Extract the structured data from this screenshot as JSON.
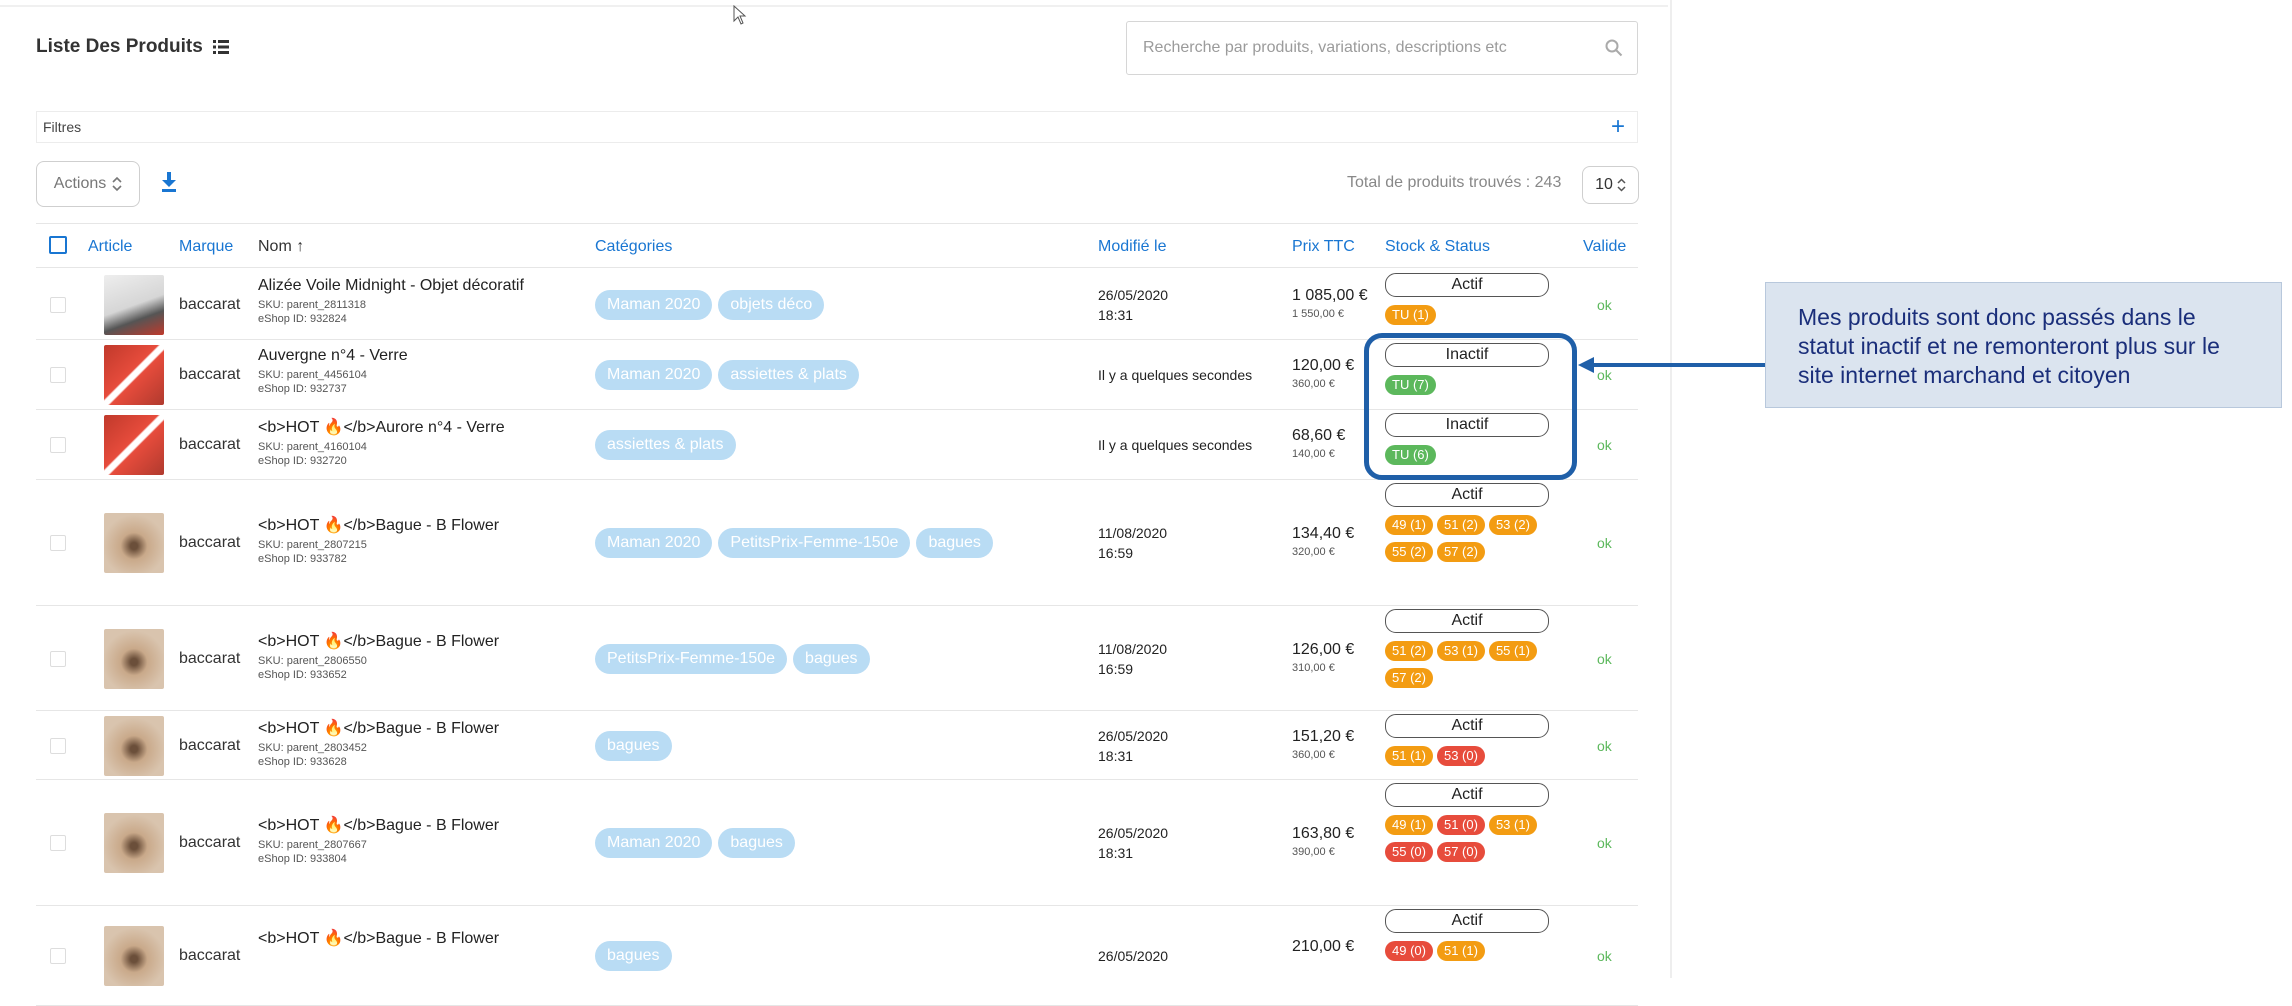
{
  "page": {
    "title": "Liste Des Produits"
  },
  "search": {
    "placeholder": "Recherche par produits, variations, descriptions etc"
  },
  "filters": {
    "label": "Filtres"
  },
  "toolbar": {
    "actions_label": "Actions",
    "total_text": "Total de produits trouvés : 243",
    "page_size": "10"
  },
  "columns": [
    "Article",
    "Marque",
    "Nom",
    "Catégories",
    "Modifié le",
    "Prix TTC",
    "Stock & Status",
    "Valide"
  ],
  "colors": {
    "accent": "#1976d2",
    "tag": "#b9dcf4",
    "orange": "#f39c12",
    "red": "#e74c3c",
    "green": "#5cb85c",
    "callout_border": "#1f5fa8"
  },
  "rows": [
    {
      "brand": "baccarat",
      "name": "Alizée Voile Midnight - Objet décoratif",
      "sku": "SKU: parent_2811318",
      "eshop": "eShop ID: 932824",
      "categories": [
        "Maman 2020",
        "objets déco"
      ],
      "modified": [
        "26/05/2020",
        "18:31"
      ],
      "price": "1 085,00 €",
      "old_price": "1 550,00 €",
      "status": "Actif",
      "badges": [
        {
          "label": "TU (1)",
          "color": "orange"
        }
      ],
      "valid": "ok"
    },
    {
      "brand": "baccarat",
      "name": "Auvergne n°4 - Verre",
      "sku": "SKU: parent_4456104",
      "eshop": "eShop ID: 932737",
      "categories": [
        "Maman 2020",
        "assiettes & plats"
      ],
      "modified": [
        "Il y a quelques secondes"
      ],
      "price": "120,00 €",
      "old_price": "360,00 €",
      "status": "Inactif",
      "badges": [
        {
          "label": "TU (7)",
          "color": "green"
        }
      ],
      "valid": "ok"
    },
    {
      "brand": "baccarat",
      "name": "<b>HOT 🔥</b>Aurore n°4 - Verre",
      "sku": "SKU: parent_4160104",
      "eshop": "eShop ID: 932720",
      "categories": [
        "assiettes & plats"
      ],
      "modified": [
        "Il y a quelques secondes"
      ],
      "price": "68,60 €",
      "old_price": "140,00 €",
      "status": "Inactif",
      "badges": [
        {
          "label": "TU (6)",
          "color": "green"
        }
      ],
      "valid": "ok"
    },
    {
      "brand": "baccarat",
      "name": "<b>HOT 🔥</b>Bague - B Flower",
      "sku": "SKU: parent_2807215",
      "eshop": "eShop ID: 933782",
      "categories": [
        "Maman 2020",
        "PetitsPrix-Femme-150e",
        "bagues"
      ],
      "modified": [
        "11/08/2020",
        "16:59"
      ],
      "price": "134,40 €",
      "old_price": "320,00 €",
      "status": "Actif",
      "badges": [
        {
          "label": "49 (1)",
          "color": "orange"
        },
        {
          "label": "51 (2)",
          "color": "orange"
        },
        {
          "label": "53 (2)",
          "color": "orange"
        },
        {
          "label": "55 (2)",
          "color": "orange"
        },
        {
          "label": "57 (2)",
          "color": "orange"
        }
      ],
      "valid": "ok"
    },
    {
      "brand": "baccarat",
      "name": "<b>HOT 🔥</b>Bague - B Flower",
      "sku": "SKU: parent_2806550",
      "eshop": "eShop ID: 933652",
      "categories": [
        "PetitsPrix-Femme-150e",
        "bagues"
      ],
      "modified": [
        "11/08/2020",
        "16:59"
      ],
      "price": "126,00 €",
      "old_price": "310,00 €",
      "status": "Actif",
      "badges": [
        {
          "label": "51 (2)",
          "color": "orange"
        },
        {
          "label": "53 (1)",
          "color": "orange"
        },
        {
          "label": "55 (1)",
          "color": "orange"
        },
        {
          "label": "57 (2)",
          "color": "orange"
        }
      ],
      "valid": "ok"
    },
    {
      "brand": "baccarat",
      "name": "<b>HOT 🔥</b>Bague - B Flower",
      "sku": "SKU: parent_2803452",
      "eshop": "eShop ID: 933628",
      "categories": [
        "bagues"
      ],
      "modified": [
        "26/05/2020",
        "18:31"
      ],
      "price": "151,20 €",
      "old_price": "360,00 €",
      "status": "Actif",
      "badges": [
        {
          "label": "51 (1)",
          "color": "orange"
        },
        {
          "label": "53 (0)",
          "color": "red"
        }
      ],
      "valid": "ok"
    },
    {
      "brand": "baccarat",
      "name": "<b>HOT 🔥</b>Bague - B Flower",
      "sku": "SKU: parent_2807667",
      "eshop": "eShop ID: 933804",
      "categories": [
        "Maman 2020",
        "bagues"
      ],
      "modified": [
        "26/05/2020",
        "18:31"
      ],
      "price": "163,80 €",
      "old_price": "390,00 €",
      "status": "Actif",
      "badges": [
        {
          "label": "49 (1)",
          "color": "orange"
        },
        {
          "label": "51 (0)",
          "color": "red"
        },
        {
          "label": "53 (1)",
          "color": "orange"
        },
        {
          "label": "55 (0)",
          "color": "red"
        },
        {
          "label": "57 (0)",
          "color": "red"
        }
      ],
      "valid": "ok"
    },
    {
      "brand": "baccarat",
      "name": "<b>HOT 🔥</b>Bague - B Flower",
      "sku": "",
      "eshop": "",
      "categories": [
        "bagues"
      ],
      "modified": [
        "26/05/2020"
      ],
      "price": "210,00 €",
      "old_price": "",
      "status": "Actif",
      "badges": [
        {
          "label": "49 (0)",
          "color": "red"
        },
        {
          "label": "51 (1)",
          "color": "orange"
        }
      ],
      "valid": "ok"
    }
  ],
  "callout": {
    "text": "Mes produits sont donc passés dans le statut inactif et ne remonteront plus sur le site internet marchand et citoyen"
  }
}
